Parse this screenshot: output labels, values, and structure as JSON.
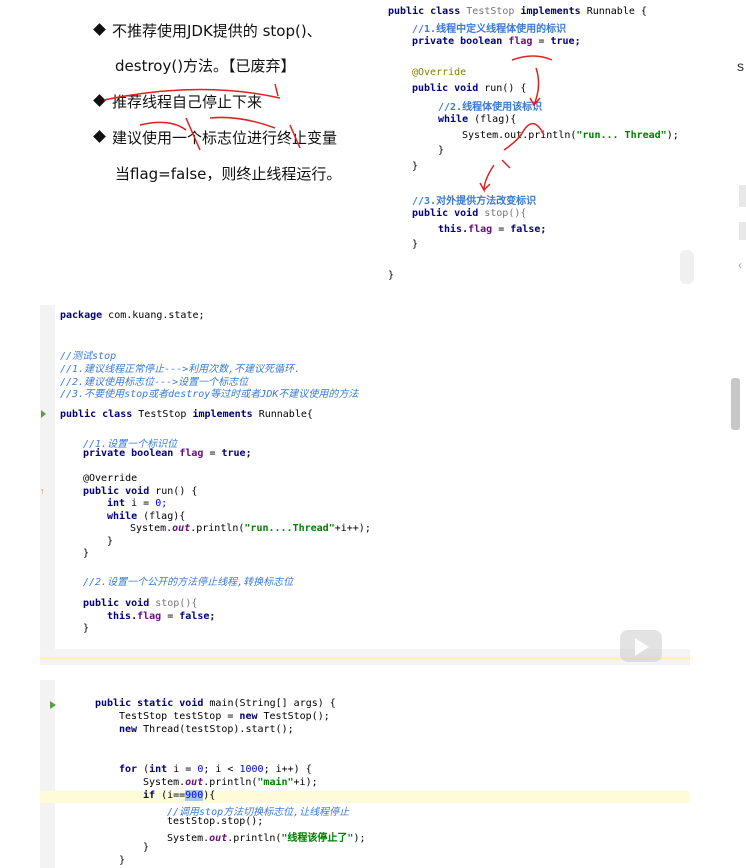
{
  "slide": {
    "bullets": [
      "不推荐使用JDK提供的 stop()、",
      "destroy()方法。【已废弃】",
      "推荐线程自己停止下来",
      "建议使用一个标志位进行终止变量",
      "当flag=false，则终止线程运行。"
    ],
    "code": {
      "l1_kw": "public class ",
      "l1_name": "TestStop ",
      "l1_kw2": "implements ",
      "l1_rest": "Runnable {",
      "l2": "//1.线程中定义线程体使用的标识",
      "l3_kw": "private boolean ",
      "l3_fld": "flag",
      "l3_rest": " = ",
      "l3_val": "true;",
      "l5": "@Override",
      "l6_kw": "public void ",
      "l6_rest": "run() {",
      "l7": "//2.线程体使用该标识",
      "l8_kw": "while ",
      "l8_rest": "(flag){",
      "l9_pre": "System.out.println(",
      "l9_str": "\"run... Thread\"",
      "l9_post": ");",
      "l10": "}",
      "l11": "}",
      "l13": "//3.对外提供方法改变标识",
      "l14_kw": "public void ",
      "l14_rest": "stop(){",
      "l15_kw": "this.",
      "l15_fld": "flag",
      "l15_rest": " = ",
      "l15_val": "false;",
      "l16": "}",
      "l18": "}"
    }
  },
  "editor1": {
    "package_kw": "package ",
    "package_name": "com.kuang.state;",
    "comments": [
      "//测试stop",
      "//1.建议线程正常停止--->利用次数,不建议死循环.",
      "//2.建议使用标志位--->设置一个标志位",
      "//3.不要使用stop或者destroy等过时或者JDK不建议使用的方法"
    ],
    "class_kw": "public class ",
    "class_name": "TestStop ",
    "class_impl": "implements ",
    "class_rest": "Runnable{",
    "c1": "//1.设置一个标识位",
    "field_kw": "private boolean ",
    "field_name": "flag",
    "field_eq": " = ",
    "field_val": "true;",
    "override": "@Override",
    "run_kw": "public void ",
    "run_rest": "run() {",
    "int_kw": "int ",
    "int_rest": "i = ",
    "int_val": "0;",
    "while_kw": "while ",
    "while_rest": "(flag){",
    "print_pre": "System.",
    "print_out": "out",
    "print_mid": ".println(",
    "print_str": "\"run....Thread\"",
    "print_post": "+i++);",
    "close1": "}",
    "close2": "}",
    "c2": "//2.设置一个公开的方法停止线程,转换标志位",
    "stop_kw": "public void ",
    "stop_rest": "stop(){",
    "this_kw": "this.",
    "this_fld": "flag",
    "this_eq": " = ",
    "this_val": "false;",
    "close3": "}"
  },
  "editor2": {
    "main_kw": "public static void ",
    "main_rest": "main(String[] args) {",
    "decl_pre": "TestStop testStop = ",
    "decl_kw": "new ",
    "decl_rest": "TestStop();",
    "thread_kw": "new ",
    "thread_rest": "Thread(testStop).start();",
    "for_kw": "for ",
    "for_a": "(",
    "for_int": "int ",
    "for_rest": "i = ",
    "for_0": "0",
    "for_b": "; i < ",
    "for_1000": "1000",
    "for_c": "; i++) {",
    "p1_pre": "System.",
    "p1_out": "out",
    "p1_mid": ".println(",
    "p1_str": "\"main\"",
    "p1_post": "+i);",
    "if_kw": "if ",
    "if_pre": "(i==",
    "if_sel": "900",
    "if_post": "){",
    "if_comment": "//调用stop方法切换标志位,让线程停止",
    "stop_call": "testStop.stop();",
    "p2_pre": "System.",
    "p2_out": "out",
    "p2_mid": ".println(",
    "p2_str": "\"线程该停止了\"",
    "p2_post": ");",
    "close_if": "}",
    "close_for": "}"
  },
  "edge": {
    "glyph": "s"
  },
  "colors": {
    "keyword": "#000080",
    "comment": "#3b7bd6",
    "string": "#008000",
    "field": "#660e7a",
    "annotation": "#808000",
    "annotation_pen": "#e02020"
  }
}
